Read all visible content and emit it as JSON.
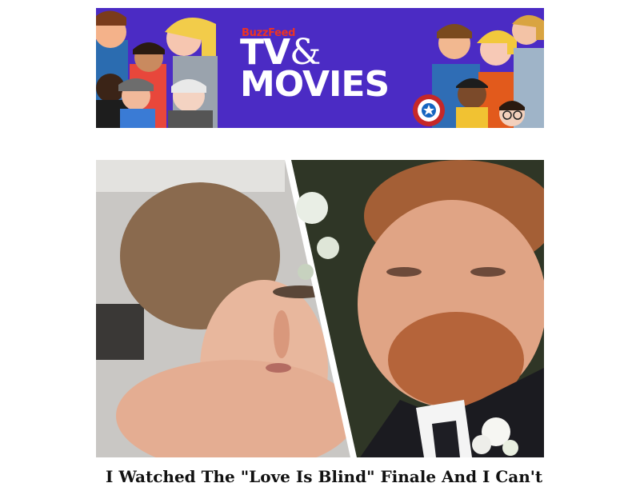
{
  "banner": {
    "brand": "BuzzFeed",
    "title_line1": "TV",
    "title_amp": "&",
    "title_line2": "MOVIES"
  },
  "article": {
    "headline": "I Watched The \"Love Is Blind\" Finale And I Can't"
  },
  "colors": {
    "banner_background": "#4b2bc4",
    "brand_red": "#ee3322"
  }
}
